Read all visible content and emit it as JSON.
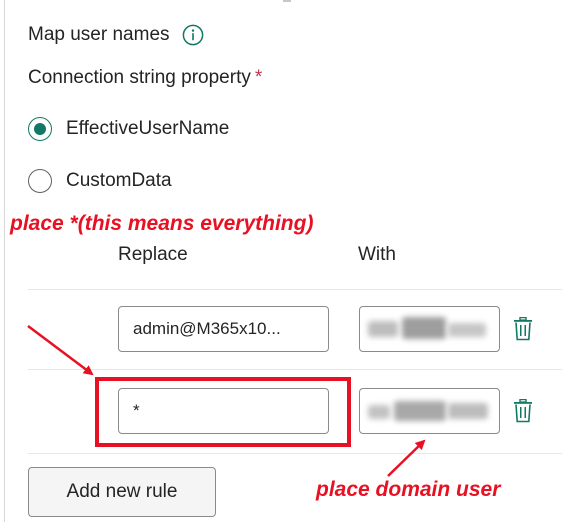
{
  "panel": {
    "title": "Map user names",
    "info_icon": "info-icon",
    "connection_label": "Connection string property",
    "required_marker": "*",
    "accent_color": "#117865",
    "radio_options": [
      {
        "label": "EffectiveUserName",
        "checked": true
      },
      {
        "label": "CustomData",
        "checked": false
      }
    ]
  },
  "rules_table": {
    "headers": {
      "replace": "Replace",
      "with": "With"
    },
    "rows": [
      {
        "replace": "admin@M365x10...",
        "with_redacted": true,
        "delete_icon": "trash-icon"
      },
      {
        "replace": "*",
        "with_redacted": true,
        "delete_icon": "trash-icon"
      }
    ],
    "add_rule_label": "Add new rule"
  },
  "annotations": {
    "top": "place *(this means everything)",
    "bottom": "place domain user",
    "color": "#e81123"
  }
}
